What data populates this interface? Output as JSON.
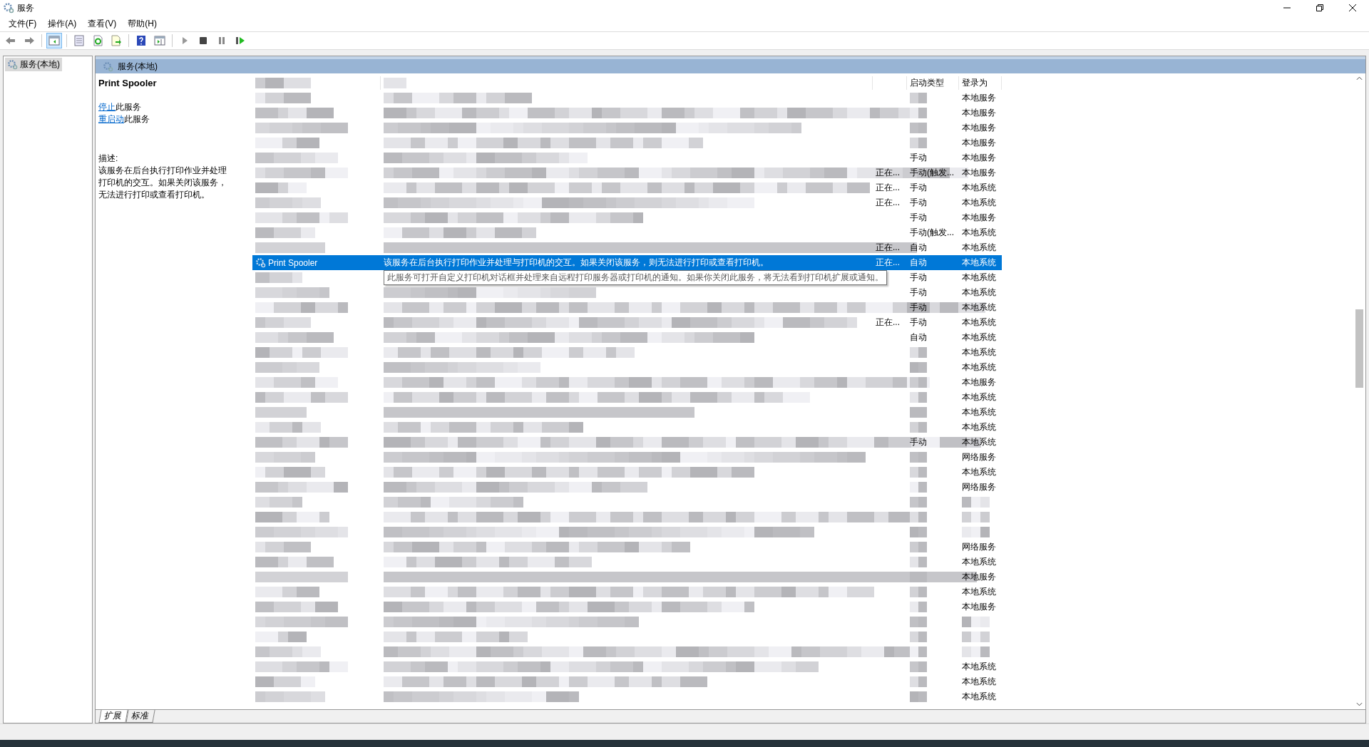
{
  "window": {
    "title": "服务"
  },
  "menu": [
    {
      "label": "文件(F)"
    },
    {
      "label": "操作(A)"
    },
    {
      "label": "查看(V)"
    },
    {
      "label": "帮助(H)"
    }
  ],
  "toolbar": [
    [
      {
        "kind": "back",
        "pressed": false
      },
      {
        "kind": "forward",
        "pressed": false
      }
    ],
    [
      {
        "kind": "tree",
        "pressed": true
      }
    ],
    [
      {
        "kind": "properties",
        "pressed": false
      },
      {
        "kind": "refresh",
        "pressed": false
      },
      {
        "kind": "export",
        "pressed": false
      }
    ],
    [
      {
        "kind": "help",
        "pressed": false
      },
      {
        "kind": "pane",
        "pressed": false
      }
    ],
    [
      {
        "kind": "play",
        "pressed": false
      },
      {
        "kind": "stop",
        "pressed": false
      },
      {
        "kind": "pause",
        "pressed": false
      },
      {
        "kind": "resume",
        "pressed": false
      }
    ]
  ],
  "tree": [
    {
      "label": "服务(本地)",
      "selected": true
    }
  ],
  "panel_title": "服务(本地)",
  "details": {
    "title": "Print Spooler",
    "actions": [
      {
        "link": "停止",
        "rest": "此服务"
      },
      {
        "link": "重启动",
        "rest": "此服务"
      }
    ],
    "description_label": "描述:",
    "description_lines": [
      "该服务在后台执行打印作业并处理",
      "打印机的交互。如果关闭该服务，",
      "无法进行打印或查看打印机。"
    ]
  },
  "columns": [
    {
      "label": "启动类型"
    },
    {
      "label": "登录为"
    }
  ],
  "rows": [
    {
      "selected": false,
      "logon": "本地服务"
    },
    {
      "selected": false,
      "logon": "本地服务"
    },
    {
      "selected": false,
      "logon": "本地服务"
    },
    {
      "selected": false,
      "logon": "本地服务"
    },
    {
      "selected": false,
      "startup": "手动",
      "logon": "本地服务"
    },
    {
      "selected": false,
      "status": "正在...",
      "startup": "手动(触发...",
      "logon": "本地服务"
    },
    {
      "selected": false,
      "status": "正在...",
      "startup": "手动",
      "logon": "本地系统"
    },
    {
      "selected": false,
      "status": "正在...",
      "startup": "手动",
      "logon": "本地系统"
    },
    {
      "selected": false,
      "startup": "手动",
      "logon": "本地服务"
    },
    {
      "selected": false,
      "startup": "手动(触发...",
      "logon": "本地系统"
    },
    {
      "selected": false,
      "status": "正在...",
      "startup": "自动",
      "logon": "本地系统"
    },
    {
      "selected": true,
      "name": "Print Spooler",
      "description": "该服务在后台执行打印作业并处理与打印机的交互。如果关闭该服务，则无法进行打印或查看打印机。",
      "status": "正在...",
      "startup": "自动",
      "logon": "本地系统"
    },
    {
      "selected": false,
      "startup": "手动",
      "logon": "本地系统"
    },
    {
      "selected": false,
      "startup": "手动",
      "logon": "本地系统"
    },
    {
      "selected": false,
      "startup": "手动",
      "logon": "本地系统"
    },
    {
      "selected": false,
      "status": "正在...",
      "startup": "手动",
      "logon": "本地系统"
    },
    {
      "selected": false,
      "startup": "自动",
      "logon": "本地系统"
    },
    {
      "selected": false,
      "logon": "本地系统"
    },
    {
      "selected": false,
      "logon": "本地系统"
    },
    {
      "selected": false,
      "logon": "本地服务"
    },
    {
      "selected": false,
      "logon": "本地系统"
    },
    {
      "selected": false,
      "logon": "本地系统"
    },
    {
      "selected": false,
      "logon": "本地系统"
    },
    {
      "selected": false,
      "startup": "手动",
      "logon": "本地系统"
    },
    {
      "selected": false,
      "logon": "网络服务"
    },
    {
      "selected": false,
      "logon": "本地系统"
    },
    {
      "selected": false,
      "logon": "网络服务"
    },
    {
      "selected": false
    },
    {
      "selected": false
    },
    {
      "selected": false
    },
    {
      "selected": false,
      "logon": "网络服务"
    },
    {
      "selected": false,
      "logon": "本地系统"
    },
    {
      "selected": false,
      "logon": "本地服务"
    },
    {
      "selected": false,
      "logon": "本地系统"
    },
    {
      "selected": false,
      "logon": "本地服务"
    },
    {
      "selected": false
    },
    {
      "selected": false
    },
    {
      "selected": false
    },
    {
      "selected": false,
      "logon": "本地系统"
    },
    {
      "selected": false,
      "logon": "本地系统"
    },
    {
      "selected": false,
      "logon": "本地系统"
    }
  ],
  "tooltip": {
    "text": "此服务可打开自定义打印机对话框并处理来自远程打印服务器或打印机的通知。如果你关闭此服务，将无法看到打印机扩展或通知。"
  },
  "view_tabs": [
    {
      "label": "扩展",
      "selected": true
    },
    {
      "label": "标准",
      "selected": false
    }
  ]
}
